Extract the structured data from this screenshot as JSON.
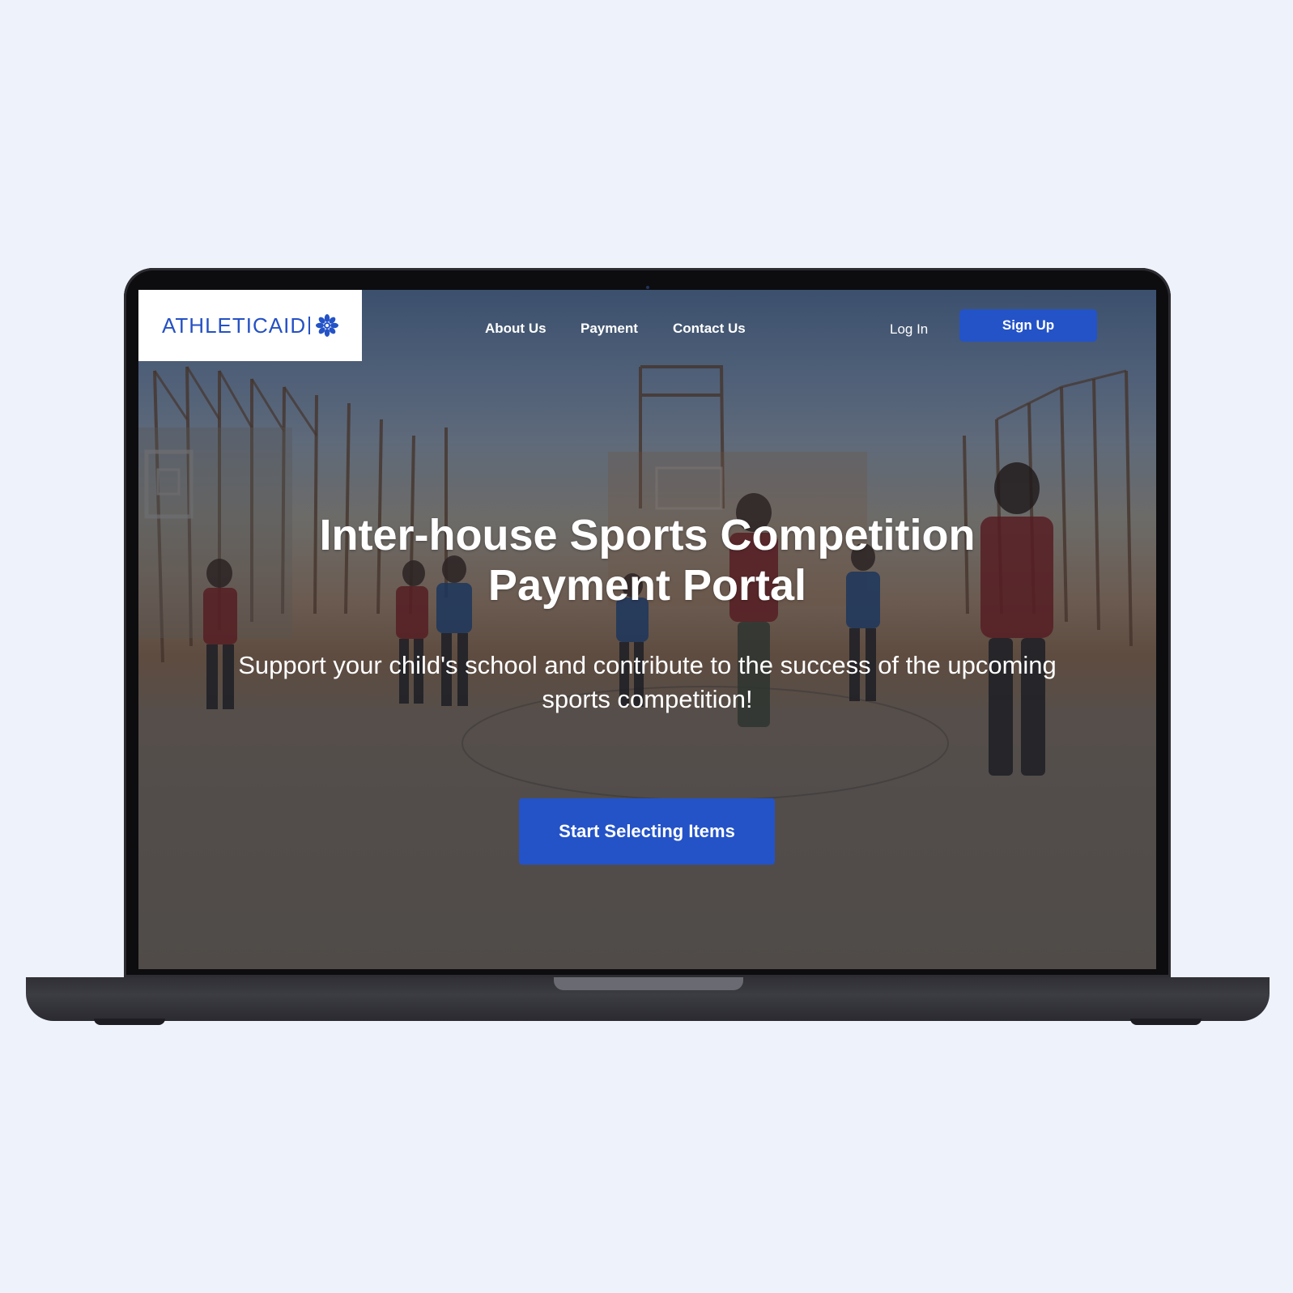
{
  "brand": {
    "name": "ATHLETICAID",
    "accent_color": "#2453c7",
    "logo_icon": "snowflake-flower-icon"
  },
  "nav": {
    "links": [
      {
        "label": "About Us"
      },
      {
        "label": "Payment"
      },
      {
        "label": "Contact Us"
      }
    ],
    "login_label": "Log In",
    "signup_label": "Sign Up"
  },
  "hero": {
    "title_line1": "Inter-house Sports Competition",
    "title_line2": "Payment Portal",
    "subtitle": "Support your child's school and contribute to the success of the upcoming sports competition!",
    "cta_label": "Start Selecting Items"
  },
  "colors": {
    "page_background": "#eef2fb",
    "button": "#2453c7",
    "overlay_text": "#ffffff"
  }
}
